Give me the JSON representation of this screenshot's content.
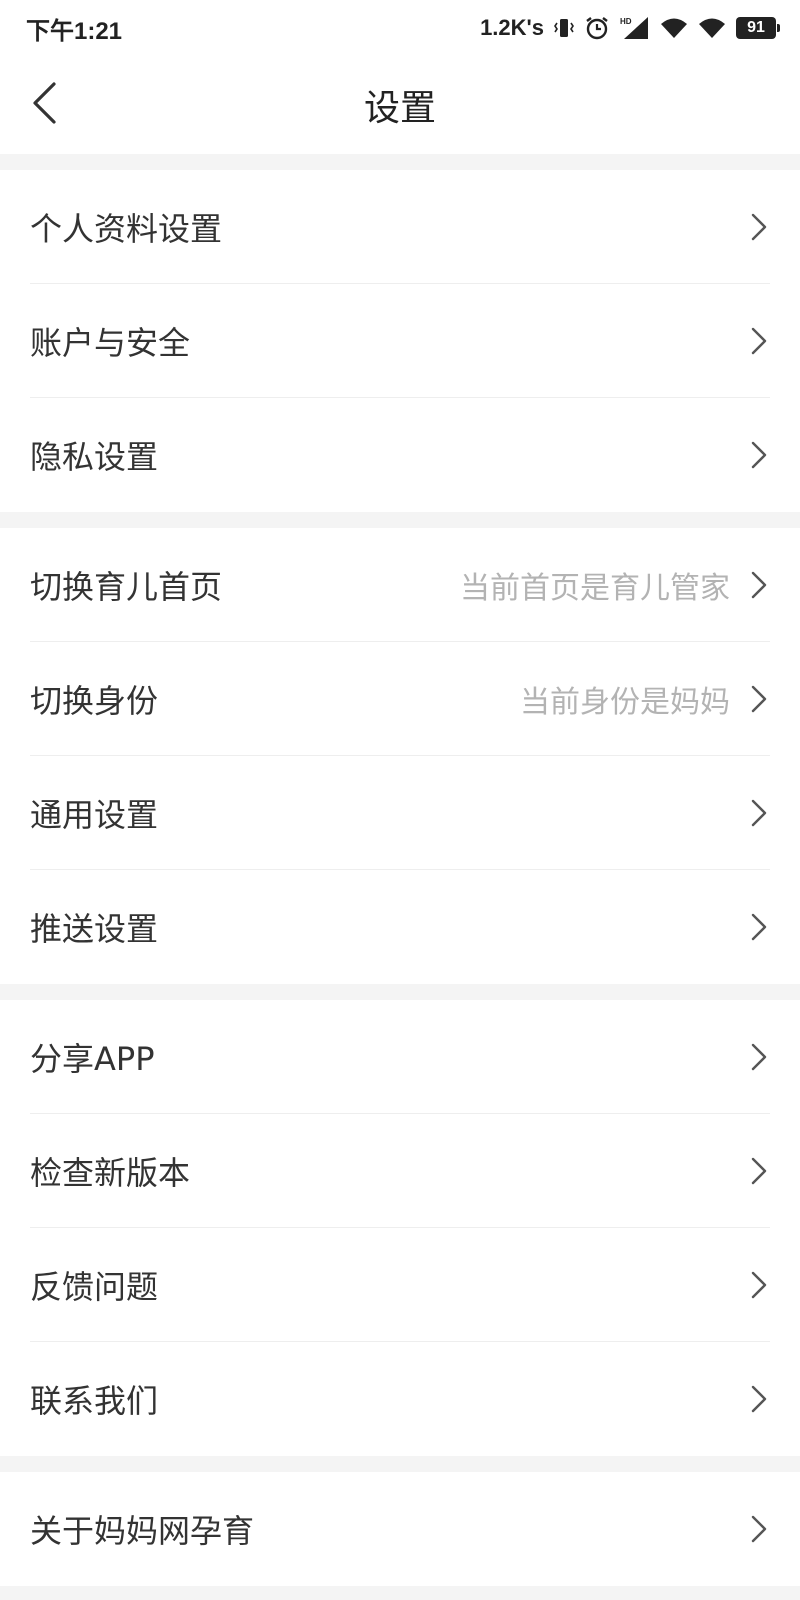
{
  "status_bar": {
    "time": "下午1:21",
    "net_speed": "1.2K's",
    "battery": "91",
    "icons": [
      "vibrate-icon",
      "alarm-icon",
      "hd-signal-icon",
      "wifi-icon",
      "wifi-icon",
      "battery-icon"
    ]
  },
  "header": {
    "title": "设置",
    "back_icon": "chevron-left-icon"
  },
  "groups": [
    {
      "items": [
        {
          "label": "个人资料设置",
          "hint": ""
        },
        {
          "label": "账户与安全",
          "hint": ""
        },
        {
          "label": "隐私设置",
          "hint": ""
        }
      ]
    },
    {
      "items": [
        {
          "label": "切换育儿首页",
          "hint": "当前首页是育儿管家"
        },
        {
          "label": "切换身份",
          "hint": "当前身份是妈妈"
        },
        {
          "label": "通用设置",
          "hint": ""
        },
        {
          "label": "推送设置",
          "hint": ""
        }
      ]
    },
    {
      "items": [
        {
          "label": "分享APP",
          "hint": ""
        },
        {
          "label": "检查新版本",
          "hint": ""
        },
        {
          "label": "反馈问题",
          "hint": ""
        },
        {
          "label": "联系我们",
          "hint": ""
        }
      ]
    },
    {
      "items": [
        {
          "label": "关于妈妈网孕育",
          "hint": ""
        }
      ]
    }
  ],
  "colors": {
    "background": "#f4f4f4",
    "surface": "#ffffff",
    "text_primary": "#333333",
    "text_hint": "#b3b3b3",
    "chevron": "#555555"
  }
}
